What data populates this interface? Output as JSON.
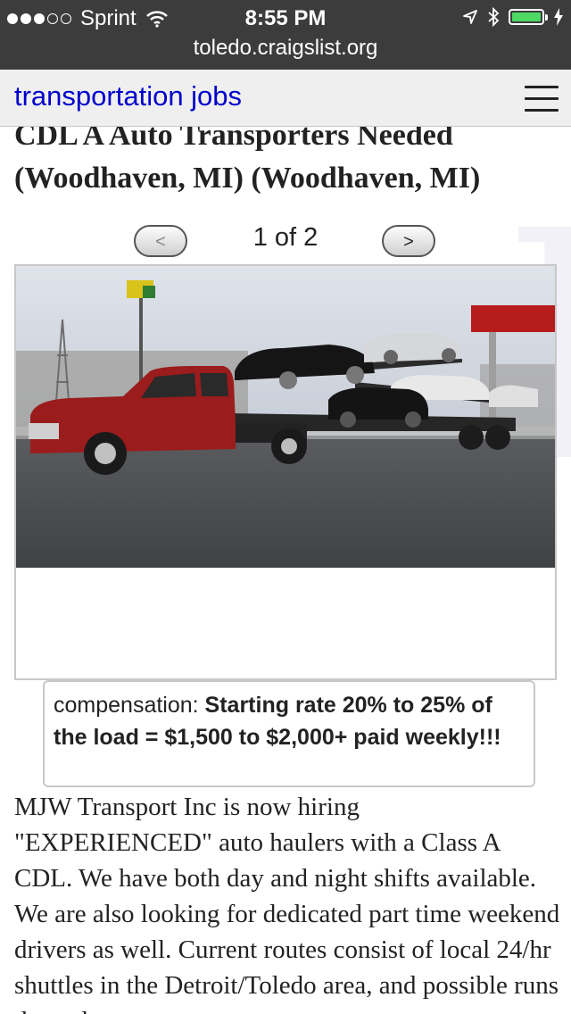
{
  "status_bar": {
    "carrier": "Sprint",
    "time": "8:55 PM",
    "signal_bars_filled": 3,
    "signal_bars_total": 5,
    "battery_color": "#4cd964"
  },
  "url_bar": {
    "url": "toledo.craigslist.org"
  },
  "nav": {
    "title": "transportation jobs",
    "menu_icon": "hamburger-icon"
  },
  "posting": {
    "title": "CDL A Auto Transporters Needed (Woodhaven, MI) (Woodhaven, MI)",
    "pager": {
      "prev_label": "<",
      "count": "1 of 2",
      "next_label": ">"
    },
    "compensation": {
      "label": "compensation: ",
      "value": "Starting rate 20% to 25% of the load = $1,500 to $2,000+ paid weekly!!!"
    },
    "body": "MJW Transport Inc is now hiring \"EXPERIENCED\" auto haulers with a Class A CDL. We have both day and night shifts available. We are also looking for dedicated part time weekend drivers as well. Current routes consist of local 24/hr shuttles in the Detroit/Toledo area, and possible runs throughout"
  },
  "colors": {
    "link": "#0000cc",
    "statusbar_bg": "#3c3c3c",
    "truck_red": "#9b1c1c"
  }
}
